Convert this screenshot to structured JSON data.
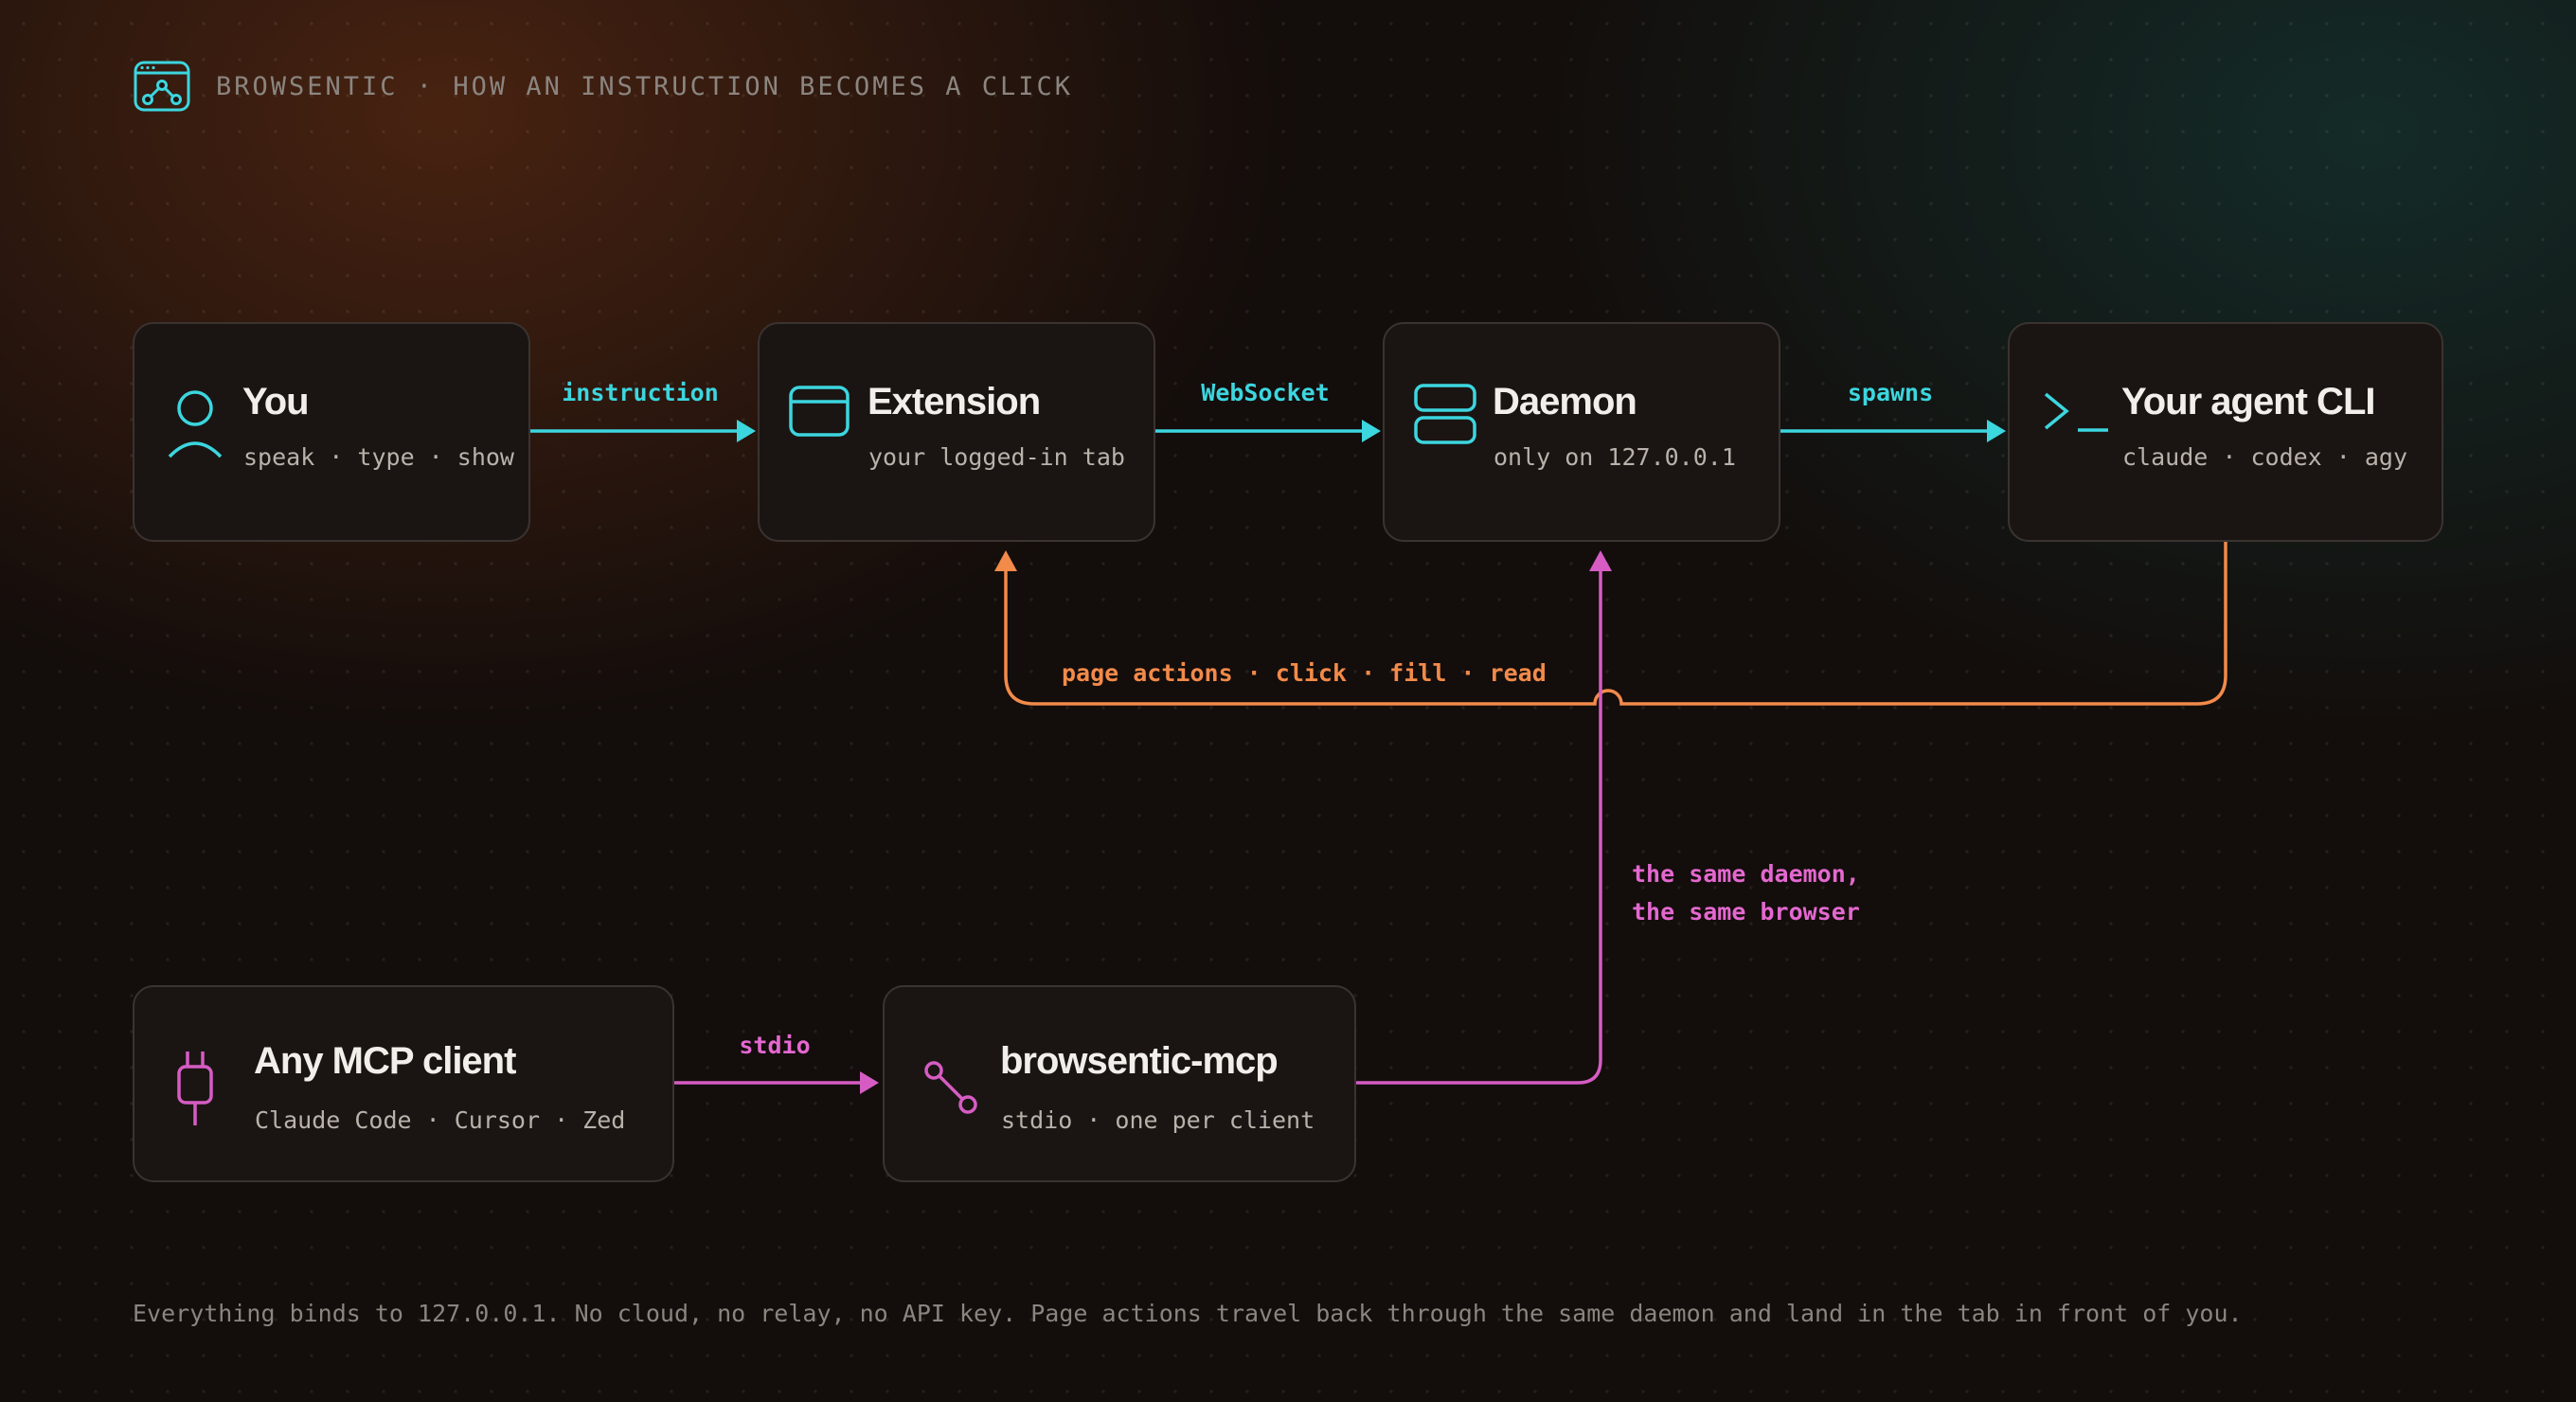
{
  "header": {
    "title": "BROWSENTIC · HOW AN INSTRUCTION BECOMES A CLICK",
    "logo_icon": "browser-window-graph-icon"
  },
  "nodes": {
    "you": {
      "title": "You",
      "subtitle": "speak · type · show",
      "icon": "person-icon"
    },
    "extension": {
      "title": "Extension",
      "subtitle": "your logged-in tab",
      "icon": "browser-window-icon"
    },
    "daemon": {
      "title": "Daemon",
      "subtitle": "only on 127.0.0.1",
      "icon": "server-icon"
    },
    "agent_cli": {
      "title": "Your agent CLI",
      "subtitle": "claude · codex · agy",
      "icon": "terminal-prompt-icon"
    },
    "mcp_client": {
      "title": "Any MCP client",
      "subtitle": "Claude Code · Cursor · Zed",
      "icon": "plug-icon"
    },
    "browsentic_mcp": {
      "title": "browsentic-mcp",
      "subtitle": "stdio · one per client",
      "icon": "connector-node-icon"
    }
  },
  "edges": {
    "instruction": "instruction",
    "websocket": "WebSocket",
    "spawns": "spawns",
    "page_actions": "page actions · click · fill · read",
    "stdio": "stdio",
    "same_daemon_line1": "the same daemon,",
    "same_daemon_line2": "the same browser"
  },
  "footer": "Everything binds to 127.0.0.1. No cloud, no relay, no API key. Page actions travel back through the same daemon and land in the tab in front of you.",
  "colors": {
    "cyan": "#3cd6df",
    "orange": "#f28a4a",
    "pink": "#d65cc4",
    "card_bg": "#1a1513",
    "card_border": "#3a3330"
  }
}
